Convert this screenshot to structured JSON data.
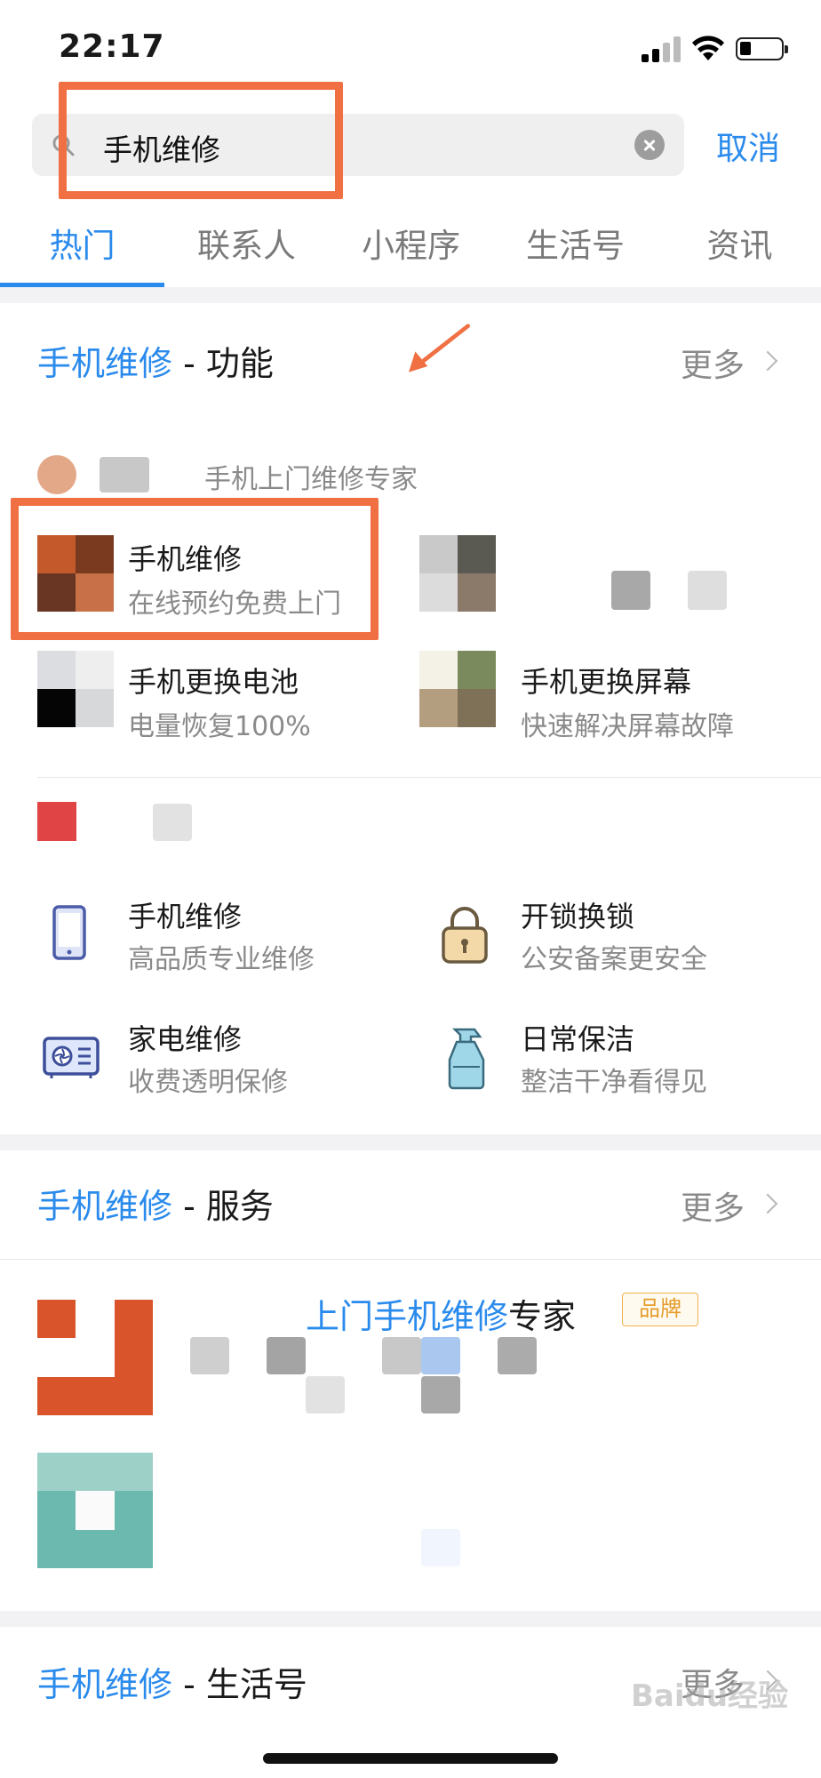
{
  "status_bar": {
    "time": "22:17"
  },
  "search": {
    "query": "手机维修",
    "cancel_label": "取消"
  },
  "tabs": [
    {
      "label": "热门"
    },
    {
      "label": "联系人"
    },
    {
      "label": "小程序"
    },
    {
      "label": "生活号"
    },
    {
      "label": "资讯"
    }
  ],
  "section_function": {
    "keyword": "手机维修",
    "suffix": " - 功能",
    "more": "更多",
    "provider_label": "手机上门维修专家",
    "items": [
      {
        "title": "手机维修",
        "subtitle": "在线预约免费上门"
      },
      {
        "title": "手机更换电池",
        "subtitle": "电量恢复100%"
      },
      {
        "title": "手机更换屏幕",
        "subtitle": "快速解决屏幕故障"
      }
    ],
    "services": [
      {
        "title": "手机维修",
        "subtitle": "高品质专业维修",
        "icon": "phone-icon"
      },
      {
        "title": "开锁换锁",
        "subtitle": "公安备案更安全",
        "icon": "padlock-icon"
      },
      {
        "title": "家电维修",
        "subtitle": "收费透明保修",
        "icon": "air-conditioner-icon"
      },
      {
        "title": "日常保洁",
        "subtitle": "整洁干净看得见",
        "icon": "spray-bottle-icon"
      }
    ]
  },
  "section_service": {
    "keyword": "手机维修",
    "suffix": " - 服务",
    "more": "更多",
    "result_title_highlight": "上门手机维修",
    "result_title_rest": "专家",
    "badge": "品牌"
  },
  "section_life": {
    "keyword": "手机维修",
    "suffix": " - 生活号",
    "more": "更多"
  },
  "watermark": "Baidu经验",
  "colors": {
    "accent": "#2b8bec",
    "annotation": "#f07043",
    "badge": "#e49c2b"
  }
}
